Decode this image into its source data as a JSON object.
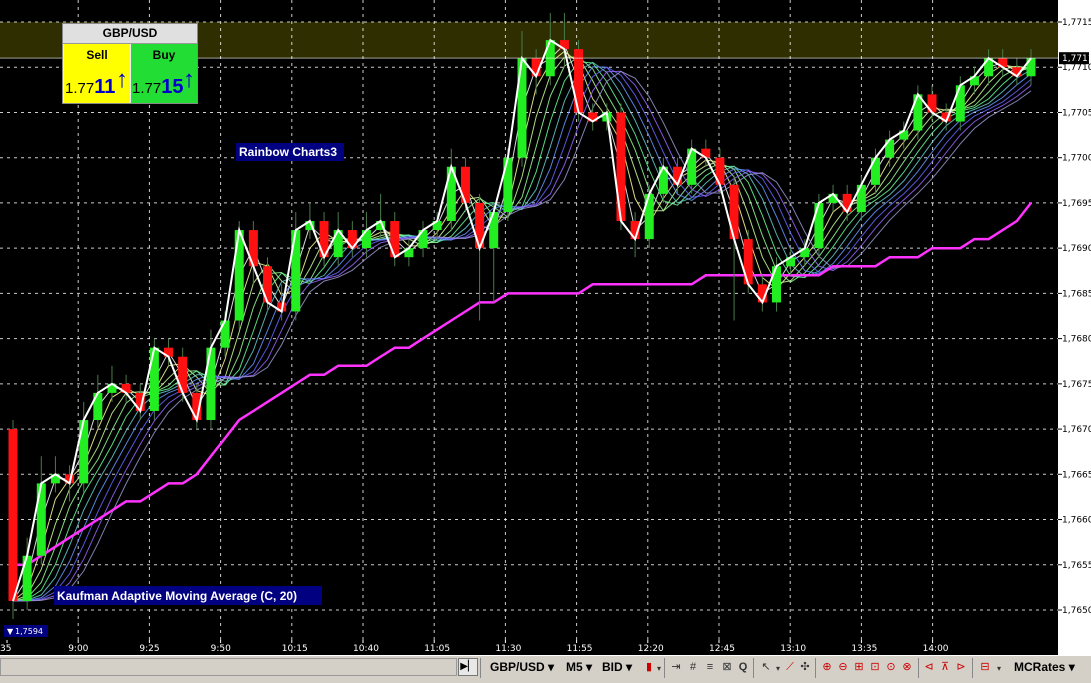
{
  "chart_data": {
    "type": "candlestick",
    "symbol": "GBP/USD",
    "y_ticks": [
      "1,7715",
      "1,7710",
      "1,7705",
      "1,7700",
      "1,7695",
      "1,7690",
      "1,7685",
      "1,7680",
      "1,7675",
      "1,7670",
      "1,7665",
      "1,7660",
      "1,7655",
      "1,7650"
    ],
    "y_range": [
      1.7645,
      1.772
    ],
    "x_ticks": [
      "35",
      "9:00",
      "9:25",
      "9:50",
      "10:15",
      "10:40",
      "11:05",
      "11:30",
      "11:55",
      "12:20",
      "12:45",
      "13:10",
      "13:35",
      "14:00"
    ],
    "current_price_label": "1,7711",
    "current_price": 1.7711,
    "low_marker_label": "1,7594",
    "candles": [
      [
        1.767,
        1.7651,
        1.7649,
        1.7671
      ],
      [
        1.7651,
        1.7656,
        1.765,
        1.7658
      ],
      [
        1.7656,
        1.7664,
        1.7655,
        1.7667
      ],
      [
        1.7664,
        1.7665,
        1.7663,
        1.7667
      ],
      [
        1.7665,
        1.7664,
        1.7662,
        1.7666
      ],
      [
        1.7664,
        1.7671,
        1.7663,
        1.7673
      ],
      [
        1.7671,
        1.7674,
        1.767,
        1.7676
      ],
      [
        1.7674,
        1.7675,
        1.7673,
        1.7677
      ],
      [
        1.7675,
        1.7674,
        1.7673,
        1.7676
      ],
      [
        1.7674,
        1.7672,
        1.7671,
        1.7675
      ],
      [
        1.7672,
        1.7679,
        1.7671,
        1.768
      ],
      [
        1.7679,
        1.7678,
        1.7677,
        1.768
      ],
      [
        1.7678,
        1.7674,
        1.7673,
        1.7679
      ],
      [
        1.7674,
        1.7671,
        1.767,
        1.7675
      ],
      [
        1.7671,
        1.7679,
        1.767,
        1.7681
      ],
      [
        1.7679,
        1.7682,
        1.7678,
        1.7683
      ],
      [
        1.7682,
        1.7692,
        1.7681,
        1.7693
      ],
      [
        1.7692,
        1.7688,
        1.7686,
        1.7693
      ],
      [
        1.7688,
        1.7684,
        1.7683,
        1.7689
      ],
      [
        1.7684,
        1.7683,
        1.7682,
        1.7686
      ],
      [
        1.7683,
        1.7692,
        1.7682,
        1.7694
      ],
      [
        1.7692,
        1.7693,
        1.7691,
        1.7695
      ],
      [
        1.7693,
        1.7689,
        1.7688,
        1.7694
      ],
      [
        1.7689,
        1.7692,
        1.7688,
        1.7694
      ],
      [
        1.7692,
        1.769,
        1.7689,
        1.7693
      ],
      [
        1.769,
        1.7692,
        1.7689,
        1.7694
      ],
      [
        1.7692,
        1.7693,
        1.7691,
        1.7696
      ],
      [
        1.7693,
        1.7689,
        1.7688,
        1.7694
      ],
      [
        1.7689,
        1.769,
        1.7688,
        1.7691
      ],
      [
        1.769,
        1.7692,
        1.7689,
        1.7693
      ],
      [
        1.7692,
        1.7693,
        1.7691,
        1.7694
      ],
      [
        1.7693,
        1.7699,
        1.7692,
        1.7701
      ],
      [
        1.7699,
        1.7695,
        1.7694,
        1.77
      ],
      [
        1.7695,
        1.769,
        1.7682,
        1.7696
      ],
      [
        1.769,
        1.7694,
        1.7684,
        1.7695
      ],
      [
        1.7694,
        1.77,
        1.7693,
        1.7701
      ],
      [
        1.77,
        1.7711,
        1.7699,
        1.7714
      ],
      [
        1.7711,
        1.7709,
        1.7707,
        1.7712
      ],
      [
        1.7709,
        1.7713,
        1.7708,
        1.7716
      ],
      [
        1.7713,
        1.7712,
        1.771,
        1.7716
      ],
      [
        1.7712,
        1.7705,
        1.7704,
        1.7713
      ],
      [
        1.7705,
        1.7704,
        1.7703,
        1.7706
      ],
      [
        1.7704,
        1.7705,
        1.7703,
        1.7706
      ],
      [
        1.7705,
        1.7693,
        1.7692,
        1.7706
      ],
      [
        1.7693,
        1.7691,
        1.7689,
        1.7694
      ],
      [
        1.7691,
        1.7696,
        1.769,
        1.7697
      ],
      [
        1.7696,
        1.7699,
        1.7695,
        1.77
      ],
      [
        1.7699,
        1.7697,
        1.7696,
        1.77
      ],
      [
        1.7697,
        1.7701,
        1.7696,
        1.7702
      ],
      [
        1.7701,
        1.77,
        1.7699,
        1.7702
      ],
      [
        1.77,
        1.7697,
        1.7696,
        1.7701
      ],
      [
        1.7697,
        1.7691,
        1.7682,
        1.7698
      ],
      [
        1.7691,
        1.7686,
        1.7685,
        1.7692
      ],
      [
        1.7686,
        1.7684,
        1.7683,
        1.7687
      ],
      [
        1.7684,
        1.7688,
        1.7683,
        1.7689
      ],
      [
        1.7688,
        1.7689,
        1.7687,
        1.769
      ],
      [
        1.7689,
        1.769,
        1.7688,
        1.7691
      ],
      [
        1.769,
        1.7695,
        1.7689,
        1.7696
      ],
      [
        1.7695,
        1.7696,
        1.7694,
        1.7697
      ],
      [
        1.7696,
        1.7694,
        1.7693,
        1.7697
      ],
      [
        1.7694,
        1.7697,
        1.7693,
        1.7698
      ],
      [
        1.7697,
        1.77,
        1.7696,
        1.7701
      ],
      [
        1.77,
        1.7702,
        1.7699,
        1.7703
      ],
      [
        1.7702,
        1.7703,
        1.7701,
        1.7704
      ],
      [
        1.7703,
        1.7707,
        1.7702,
        1.7708
      ],
      [
        1.7707,
        1.7705,
        1.7704,
        1.7708
      ],
      [
        1.7705,
        1.7704,
        1.7703,
        1.7706
      ],
      [
        1.7704,
        1.7708,
        1.7703,
        1.7709
      ],
      [
        1.7708,
        1.7709,
        1.7707,
        1.771
      ],
      [
        1.7709,
        1.7711,
        1.7708,
        1.7712
      ],
      [
        1.7711,
        1.771,
        1.7709,
        1.7712
      ],
      [
        1.771,
        1.7709,
        1.7708,
        1.7711
      ],
      [
        1.7709,
        1.7711,
        1.7708,
        1.7712
      ]
    ],
    "kama": [
      1.7655,
      1.7655,
      1.7656,
      1.7657,
      1.7658,
      1.7659,
      1.766,
      1.7661,
      1.7662,
      1.7662,
      1.7663,
      1.7664,
      1.7664,
      1.7665,
      1.7667,
      1.7669,
      1.7671,
      1.7672,
      1.7673,
      1.7674,
      1.7675,
      1.7676,
      1.7676,
      1.7677,
      1.7677,
      1.7677,
      1.7678,
      1.7679,
      1.7679,
      1.768,
      1.7681,
      1.7682,
      1.7683,
      1.7684,
      1.7684,
      1.7685,
      1.7685,
      1.7685,
      1.7685,
      1.7685,
      1.7685,
      1.7686,
      1.7686,
      1.7686,
      1.7686,
      1.7686,
      1.7686,
      1.7686,
      1.7686,
      1.7687,
      1.7687,
      1.7687,
      1.7687,
      1.7687,
      1.7687,
      1.7687,
      1.7687,
      1.7687,
      1.7688,
      1.7688,
      1.7688,
      1.7688,
      1.7689,
      1.7689,
      1.7689,
      1.769,
      1.769,
      1.769,
      1.7691,
      1.7691,
      1.7692,
      1.7693,
      1.7695
    ],
    "rainbow_colors": [
      "#ffffff",
      "#ffff99",
      "#ccff99",
      "#99ff99",
      "#66ff99",
      "#66cccc",
      "#6699ff",
      "#6666ff",
      "#9966ff",
      "#9999cc"
    ],
    "annotations": {
      "rainbow_label": "Rainbow Charts3",
      "kama_label": "Kaufman Adaptive Moving Average (C, 20)"
    },
    "colors": {
      "up_candle": "#22ee22",
      "down_candle": "#ff1111",
      "kama": "#ff33ff",
      "close_line": "#ffffff",
      "grid": "#ffffff",
      "background": "#000000"
    }
  },
  "quote_panel": {
    "pair": "GBP/USD",
    "sell_label": "Sell",
    "buy_label": "Buy",
    "sell_price_prefix": "1.77",
    "sell_price_big": "11",
    "buy_price_prefix": "1.77",
    "buy_price_big": "15"
  },
  "toolbar": {
    "symbol": "GBP/USD",
    "timeframe": "M5",
    "price_type": "BID",
    "provider": "MCRates"
  }
}
